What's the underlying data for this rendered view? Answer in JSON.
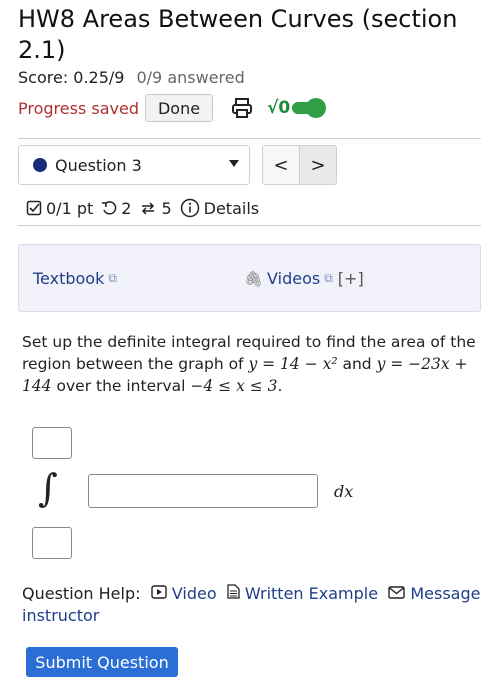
{
  "header": {
    "title": "HW8 Areas Between Curves (section 2.1)",
    "score": "Score: 0.25/9",
    "answered": "0/9 answered",
    "progress": "Progress saved",
    "done_label": "Done",
    "sqrt_label": "√0"
  },
  "question_nav": {
    "selected": "Question 3",
    "prev": "<",
    "next": ">"
  },
  "meta": {
    "points": "0/1 pt",
    "retries": "2",
    "attempts": "5",
    "details": "Details"
  },
  "resources": {
    "textbook": "Textbook",
    "videos": "Videos",
    "expand": "[+]"
  },
  "question": {
    "text_1": "Set up the definite integral required to find the area of the region between the graph of ",
    "eq1": "y = 14 − x²",
    "text_2": " and ",
    "eq2": "y = −23x + 144",
    "text_3": " over the interval ",
    "eq3": "−4 ≤ x ≤ 3",
    "text_4": ".",
    "integral_symbol": "∫",
    "differential": "dx"
  },
  "help": {
    "label": "Question Help:",
    "video": "Video",
    "written_example": "Written Example",
    "message": "Message instructor"
  },
  "submit_label": "Submit Question",
  "colors": {
    "accent": "#2b6fd6",
    "progress_red": "#b03030",
    "toggle_green": "#2f9e44",
    "link_blue": "#1f3f8a"
  }
}
